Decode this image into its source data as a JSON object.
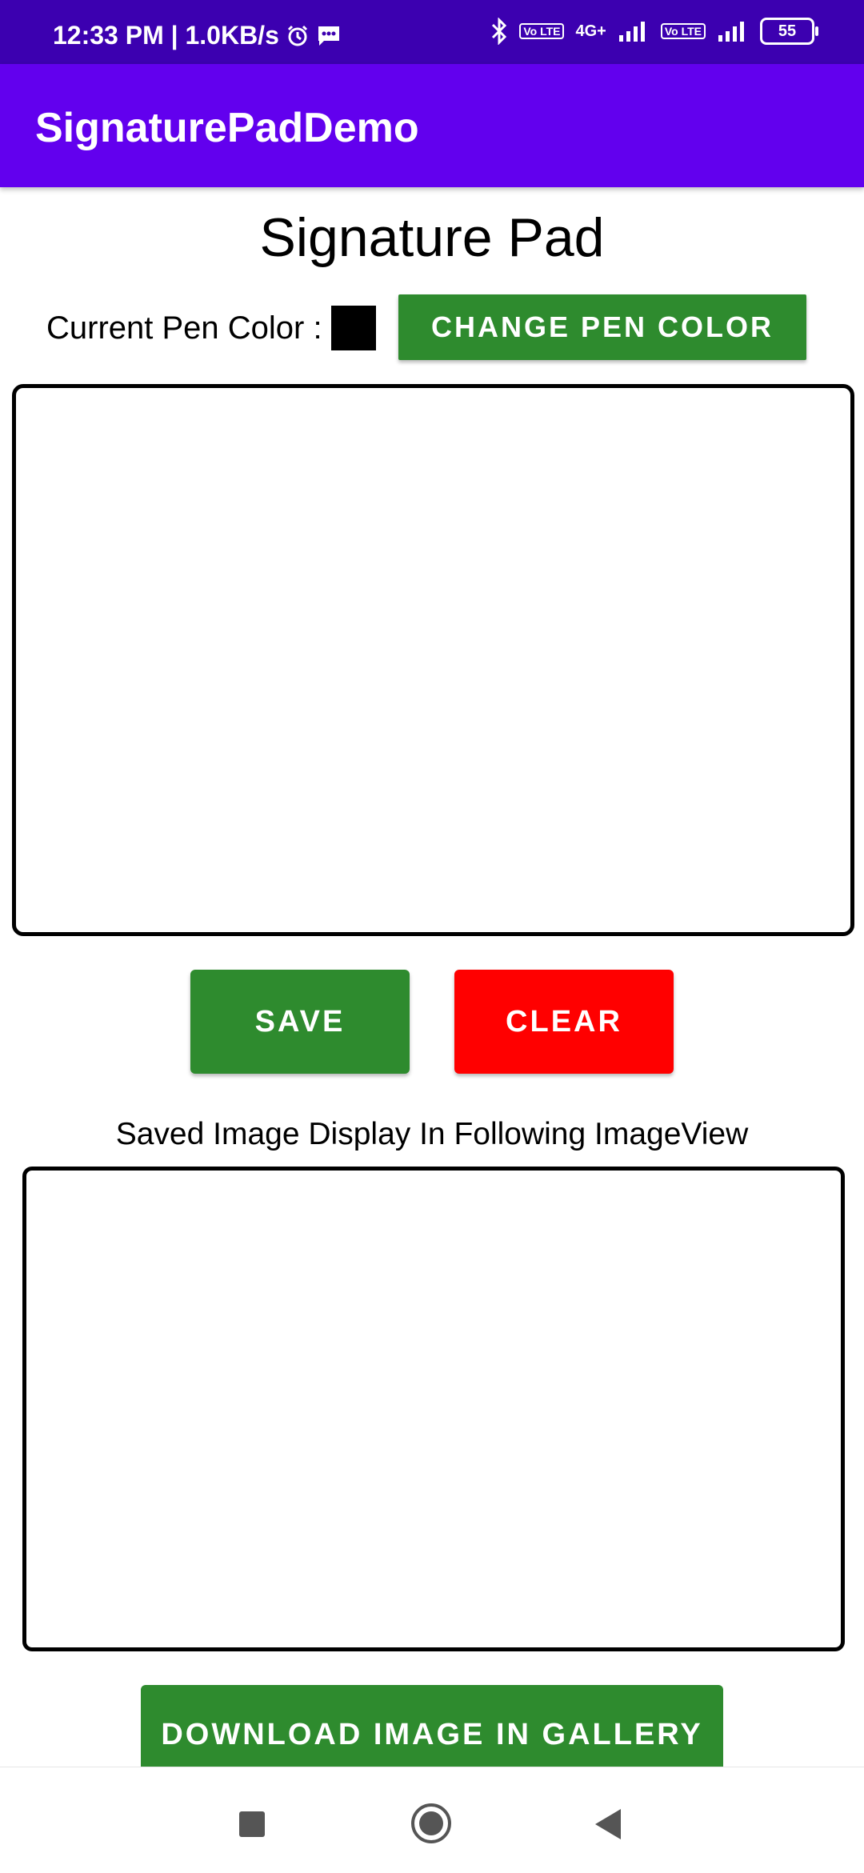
{
  "status_bar": {
    "time_and_speed": "12:33 PM | 1.0KB/s",
    "network_4g": "4G+",
    "volte_label": "Vo LTE",
    "battery": "55"
  },
  "app_bar": {
    "title": "SignaturePadDemo"
  },
  "main": {
    "heading": "Signature Pad",
    "pen_color_label": "Current Pen Color :",
    "pen_color_value": "#000000",
    "change_pen_color_button": "CHANGE PEN COLOR",
    "save_button": "SAVE",
    "clear_button": "CLEAR",
    "saved_image_label": "Saved Image Display In Following ImageView",
    "download_button": "DOWNLOAD IMAGE IN GALLERY"
  },
  "colors": {
    "status_bar": "#3c00b0",
    "app_bar": "#6200ee",
    "green_button": "#2e8b2e",
    "red_button": "#ff0000"
  },
  "nav_bar": {
    "icons": [
      "recents-square-icon",
      "home-circle-icon",
      "back-triangle-icon"
    ]
  }
}
